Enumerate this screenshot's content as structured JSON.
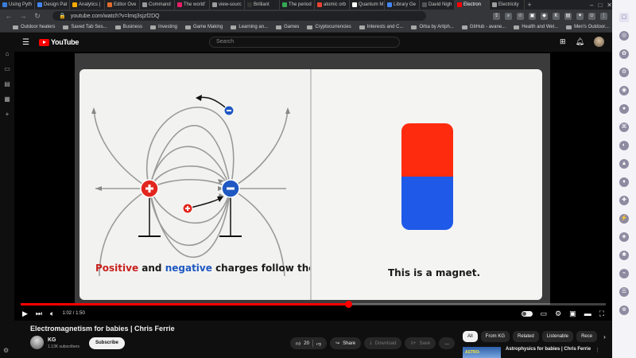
{
  "browser": {
    "tabs": [
      {
        "label": "Using Pyth",
        "color": "#3b7ddd"
      },
      {
        "label": "Design Pat",
        "color": "#4285f4"
      },
      {
        "label": "Analytics |",
        "color": "#f9ab00"
      },
      {
        "label": "Editor Ove",
        "color": "#e06c2c"
      },
      {
        "label": "Command",
        "color": "#999999"
      },
      {
        "label": "The world'",
        "color": "#e91e63"
      },
      {
        "label": "view-sourc",
        "color": "#9e9e9e"
      },
      {
        "label": "Brilliant",
        "color": "#333333"
      },
      {
        "label": "The period",
        "color": "#34a853"
      },
      {
        "label": "atomic orb",
        "color": "#ea4335"
      },
      {
        "label": "Quantum M",
        "color": "#ffffff"
      },
      {
        "label": "Library Ge",
        "color": "#4285f4"
      },
      {
        "label": "David Nigh",
        "color": "#555555"
      },
      {
        "label": "Electron",
        "color": "#ff0000",
        "active": true
      },
      {
        "label": "Electricity",
        "color": "#9e9e9e"
      }
    ],
    "url": "youtube.com/watch?v=lmq3sjzf2DQ",
    "bookmarks": [
      "Outdoor heaters",
      "Saved Tab Ses...",
      "Business",
      "Investing",
      "Game Making",
      "Learning an...",
      "Games",
      "Cryptocurrencies",
      "Interests and C...",
      "Orba by Artiph...",
      "GitHub - avane...",
      "Health and Wel...",
      "Men's Outdoor..."
    ]
  },
  "youtube": {
    "logo_text": "YouTube",
    "search_placeholder": "Search",
    "video": {
      "left_caption_positive": "Positive",
      "left_caption_and": " and ",
      "left_caption_negative": "negative",
      "left_caption_rest": " charges follow them.",
      "right_caption": "This is a magnet.",
      "progress": 0.56,
      "time_current": "1:02",
      "time_separator": " / ",
      "time_total": "1:50"
    },
    "title": "Electromagnetism for babies | Chris Ferrie",
    "channel": {
      "name": "KG",
      "subscribers": "1.13K subscribers",
      "subscribe_label": "Subscribe"
    },
    "actions": {
      "likes": "20",
      "share": "Share",
      "download": "Download",
      "save": "Save",
      "more": "…"
    },
    "chips": [
      "All",
      "From KG",
      "Related",
      "Listenable",
      "Rece"
    ],
    "recommendation": {
      "title": "Astrophysics for babies | Chris Ferrie",
      "thumb_text": "ASTRO-"
    }
  }
}
